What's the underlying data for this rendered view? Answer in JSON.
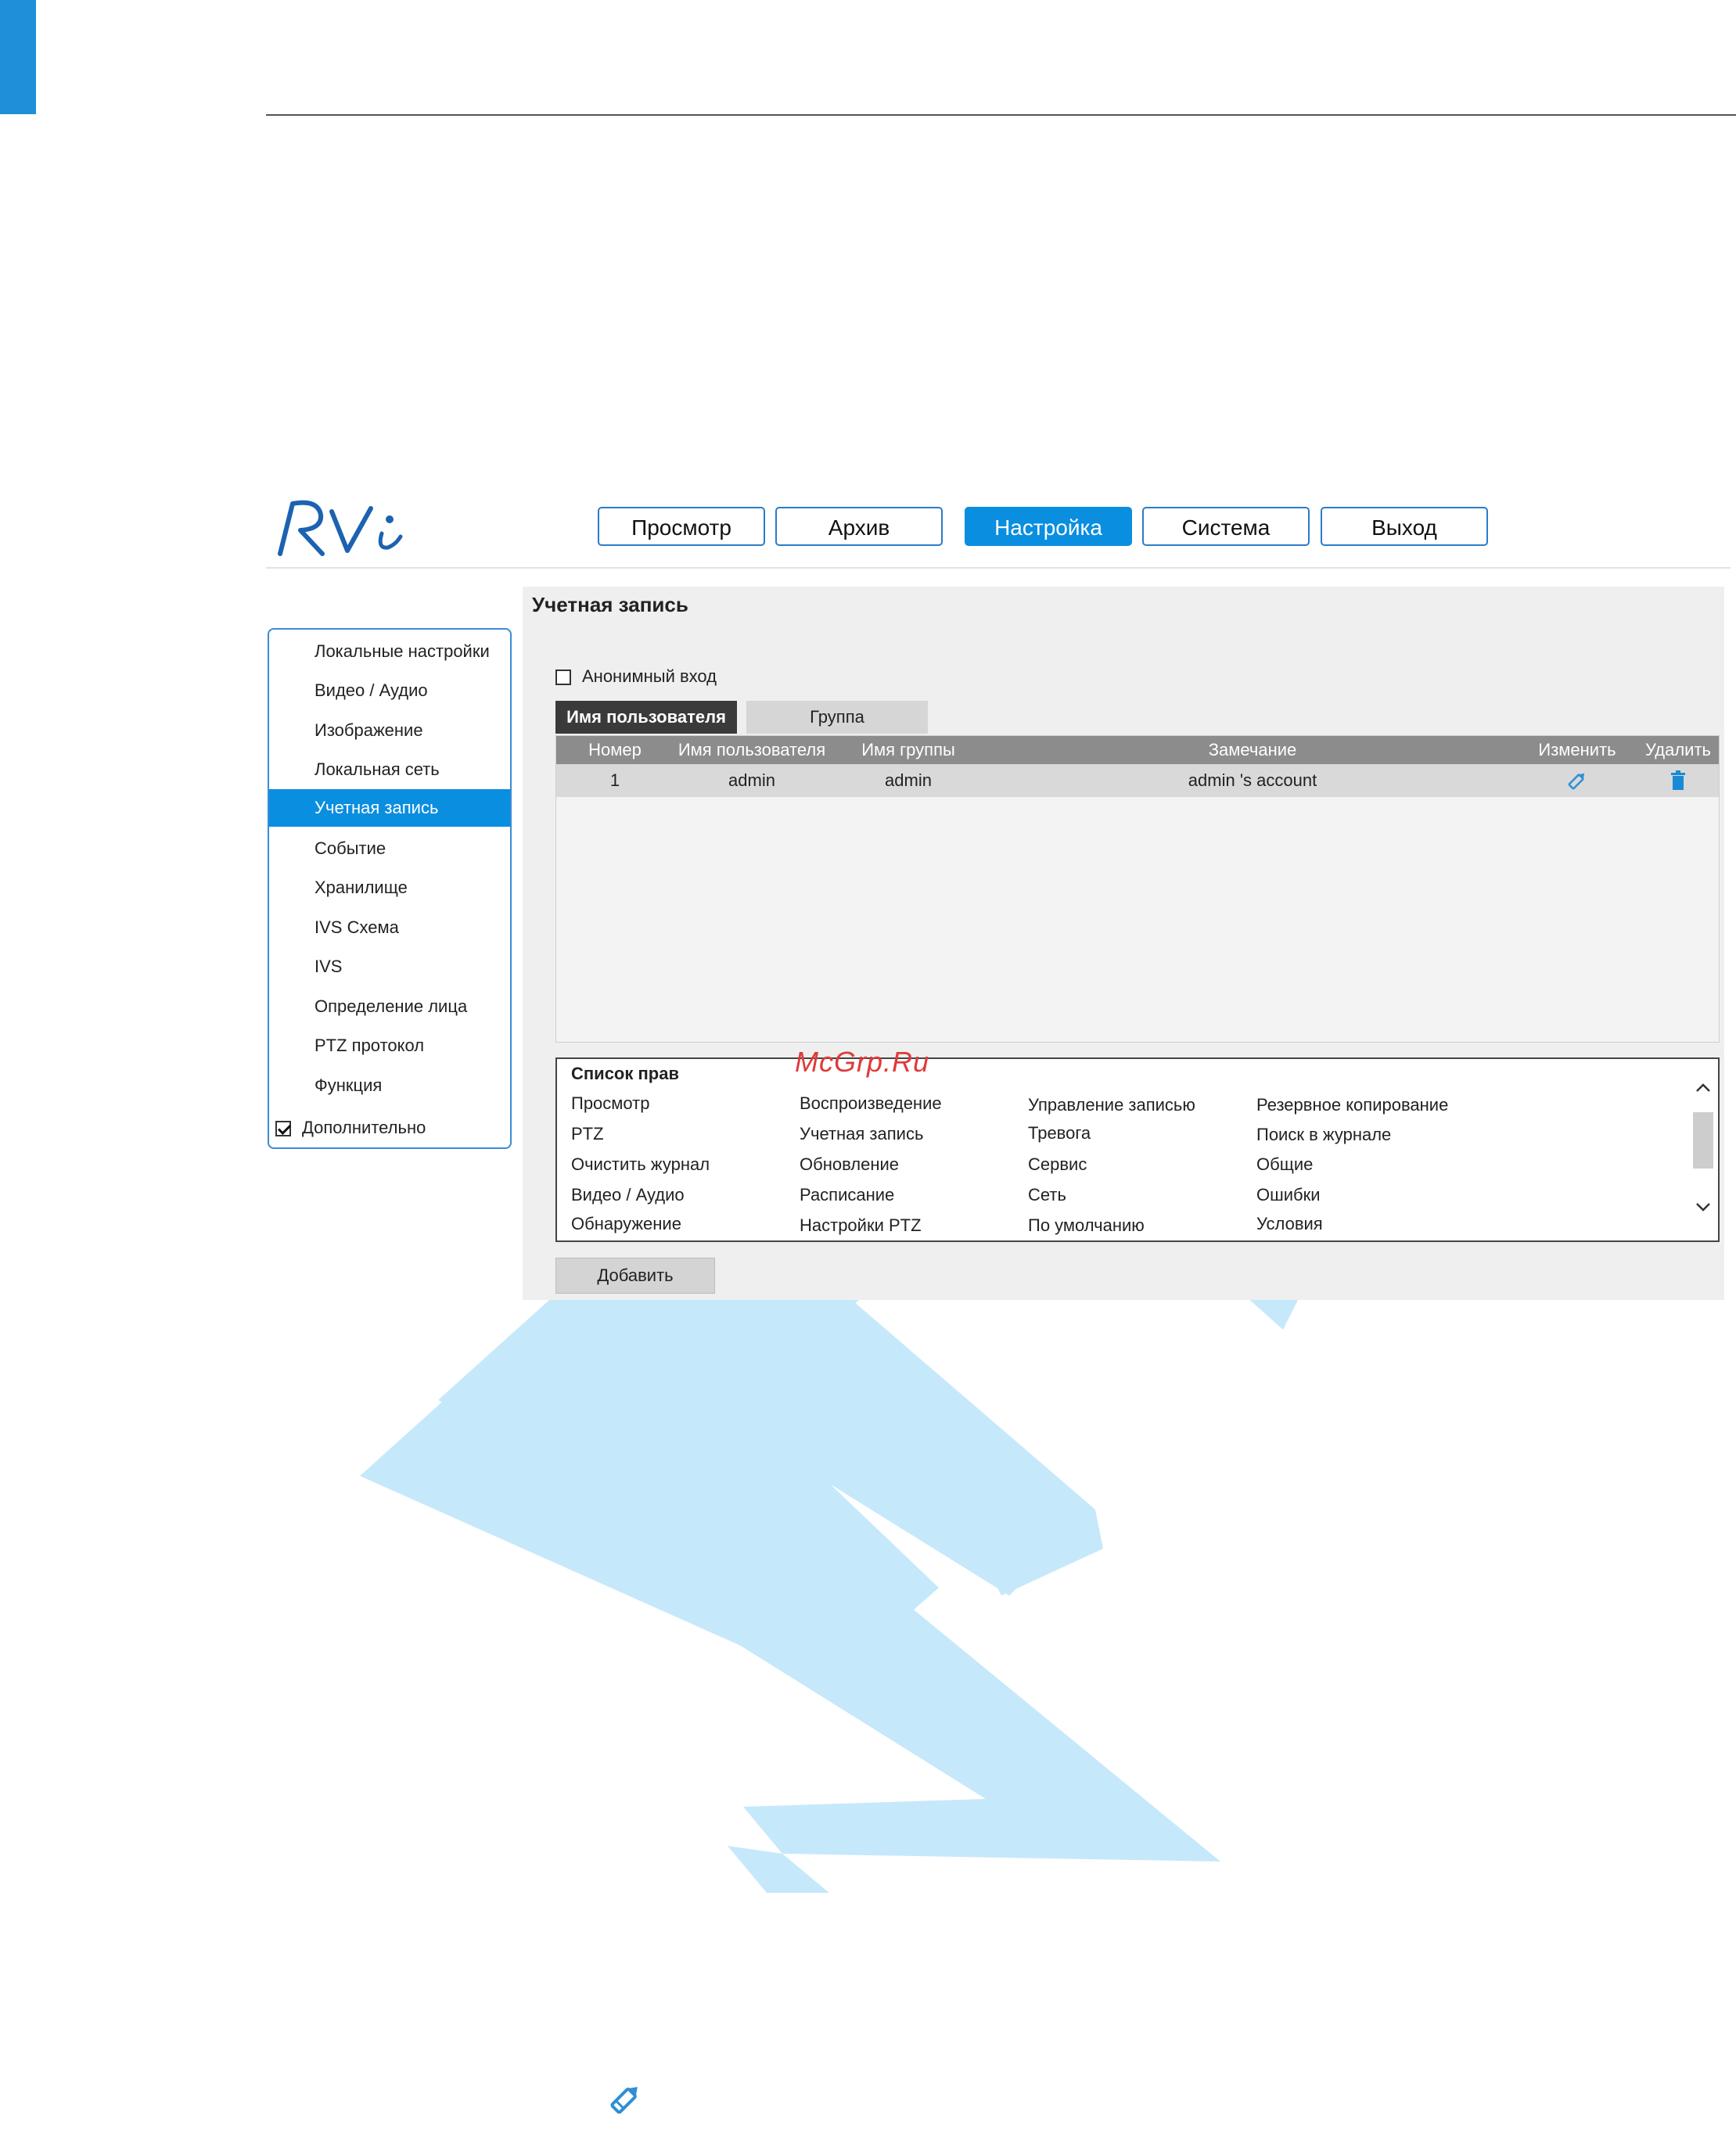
{
  "brand": {
    "logo_text": "RVi",
    "accent": "#0a8ee0"
  },
  "nav": {
    "items": [
      {
        "label": "Просмотр",
        "active": false
      },
      {
        "label": "Архив",
        "active": false
      },
      {
        "label": "Настройка",
        "active": true
      },
      {
        "label": "Система",
        "active": false
      },
      {
        "label": "Выход",
        "active": false
      }
    ]
  },
  "sidebar": {
    "items": [
      {
        "label": "Локальные настройки"
      },
      {
        "label": "Видео / Аудио"
      },
      {
        "label": "Изображение"
      },
      {
        "label": "Локальная сеть"
      },
      {
        "label": "Учетная запись",
        "active": true
      },
      {
        "label": "Событие"
      },
      {
        "label": "Хранилище"
      },
      {
        "label": "IVS Схема"
      },
      {
        "label": "IVS"
      },
      {
        "label": "Определение лица"
      },
      {
        "label": "PTZ протокол"
      },
      {
        "label": "Функция"
      }
    ],
    "more": {
      "label": "Дополнительно",
      "checked": true
    }
  },
  "page": {
    "title": "Учетная запись",
    "anonymous_login": {
      "label": "Анонимный вход",
      "checked": false
    },
    "tabs": [
      {
        "label": "Имя пользователя",
        "active": true
      },
      {
        "label": "Группа",
        "active": false
      }
    ]
  },
  "users_table": {
    "columns": [
      "Номер",
      "Имя пользователя",
      "Имя группы",
      "Замечание",
      "Изменить",
      "Удалить"
    ],
    "rows": [
      {
        "number": "1",
        "username": "admin",
        "group": "admin",
        "note": "admin 's account",
        "edit_icon": "pencil-icon",
        "delete_icon": "trash-icon"
      }
    ]
  },
  "permissions": {
    "title": "Список прав",
    "columns": [
      [
        "Просмотр",
        "PTZ",
        "Очистить журнал",
        "Видео / Аудио",
        "Обнаружение"
      ],
      [
        "Воспроизведение",
        "Учетная запись",
        "Обновление",
        "Расписание",
        "Настройки PTZ"
      ],
      [
        "Управление записью",
        "Тревога",
        "Сервис",
        "Сеть",
        "По умолчанию"
      ],
      [
        "Резервное копирование",
        "Поиск в журнале",
        "Общие",
        "Ошибки",
        "Условия"
      ]
    ]
  },
  "add_button": {
    "label": "Добавить"
  },
  "site_mark": "McGrp.Ru",
  "icons": {
    "edit": "pencil-icon",
    "delete": "trash-icon",
    "scroll_up": "chevron-up-icon",
    "scroll_down": "chevron-down-icon"
  },
  "colors": {
    "tab_active_bg": "#3a3a3a",
    "table_header_bg": "#8c8c8c",
    "watermark": "#c6e8fb"
  }
}
